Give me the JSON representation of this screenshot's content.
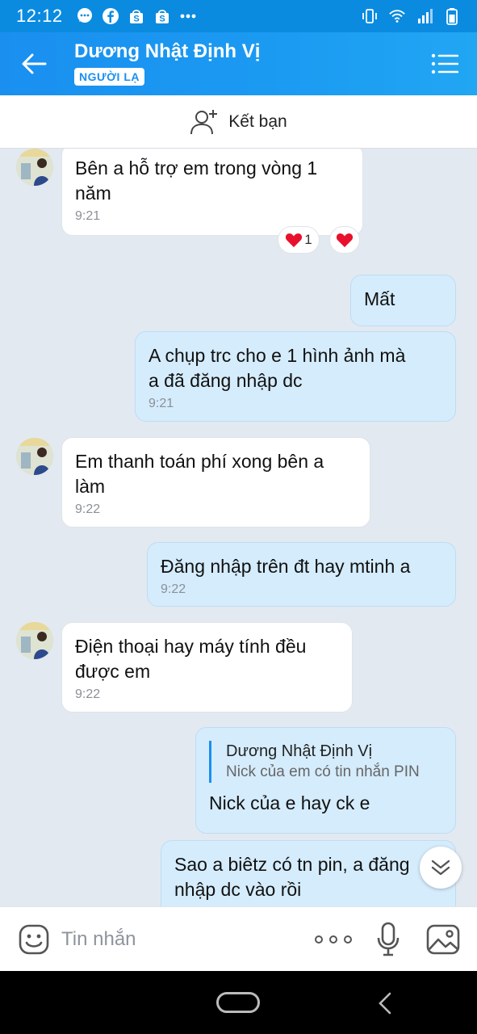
{
  "status_bar": {
    "time": "12:12",
    "left_icons": [
      "chat-bubble-icon",
      "facebook-icon",
      "shop-icon",
      "shop-icon",
      "more-dots-icon"
    ],
    "right_icons": [
      "vibrate-icon",
      "wifi-icon",
      "signal-icon",
      "battery-icon"
    ]
  },
  "header": {
    "contact_name": "Dương Nhật Định Vị",
    "badge": "NGƯỜI LẠ"
  },
  "add_friend": {
    "label": "Kết bạn"
  },
  "messages": [
    {
      "direction": "in",
      "lines": [
        "Bên a hỗ trợ em trong vòng 1",
        "năm"
      ],
      "time": "9:21",
      "reactions": [
        {
          "icon": "heart-icon",
          "count": "1"
        },
        {
          "icon": "heart-icon",
          "count": ""
        }
      ]
    },
    {
      "direction": "out",
      "lines": [
        "Mất"
      ],
      "time": ""
    },
    {
      "direction": "out",
      "lines": [
        "A chụp trc cho e 1 hình ảnh mà",
        "a đã đăng nhập dc"
      ],
      "time": "9:21"
    },
    {
      "direction": "in",
      "lines": [
        "Em thanh toán phí xong bên a",
        "làm"
      ],
      "time": "9:22"
    },
    {
      "direction": "out",
      "lines": [
        "Đăng nhập trên đt hay mtinh a"
      ],
      "time": "9:22"
    },
    {
      "direction": "in",
      "lines": [
        "Điện thoại hay máy tính đều",
        "được em"
      ],
      "time": "9:22"
    },
    {
      "direction": "out",
      "quote": {
        "name": "Dương Nhật Định Vị",
        "text": "Nick của em có tin nhắn PIN"
      },
      "lines": [
        "Nick của e hay ck e"
      ],
      "time": ""
    },
    {
      "direction": "out",
      "lines": [
        "Sao a biêtz có tn pin, a đăng",
        "nhập dc vào rồi"
      ],
      "time": ""
    }
  ],
  "input_bar": {
    "placeholder": "Tin nhắn"
  },
  "colors": {
    "header_blue": "#1a8ff0",
    "outgoing_bubble": "#d5ecfc",
    "incoming_bubble": "#ffffff",
    "chat_background": "#e2e9f1",
    "heart": "#e8112d"
  }
}
